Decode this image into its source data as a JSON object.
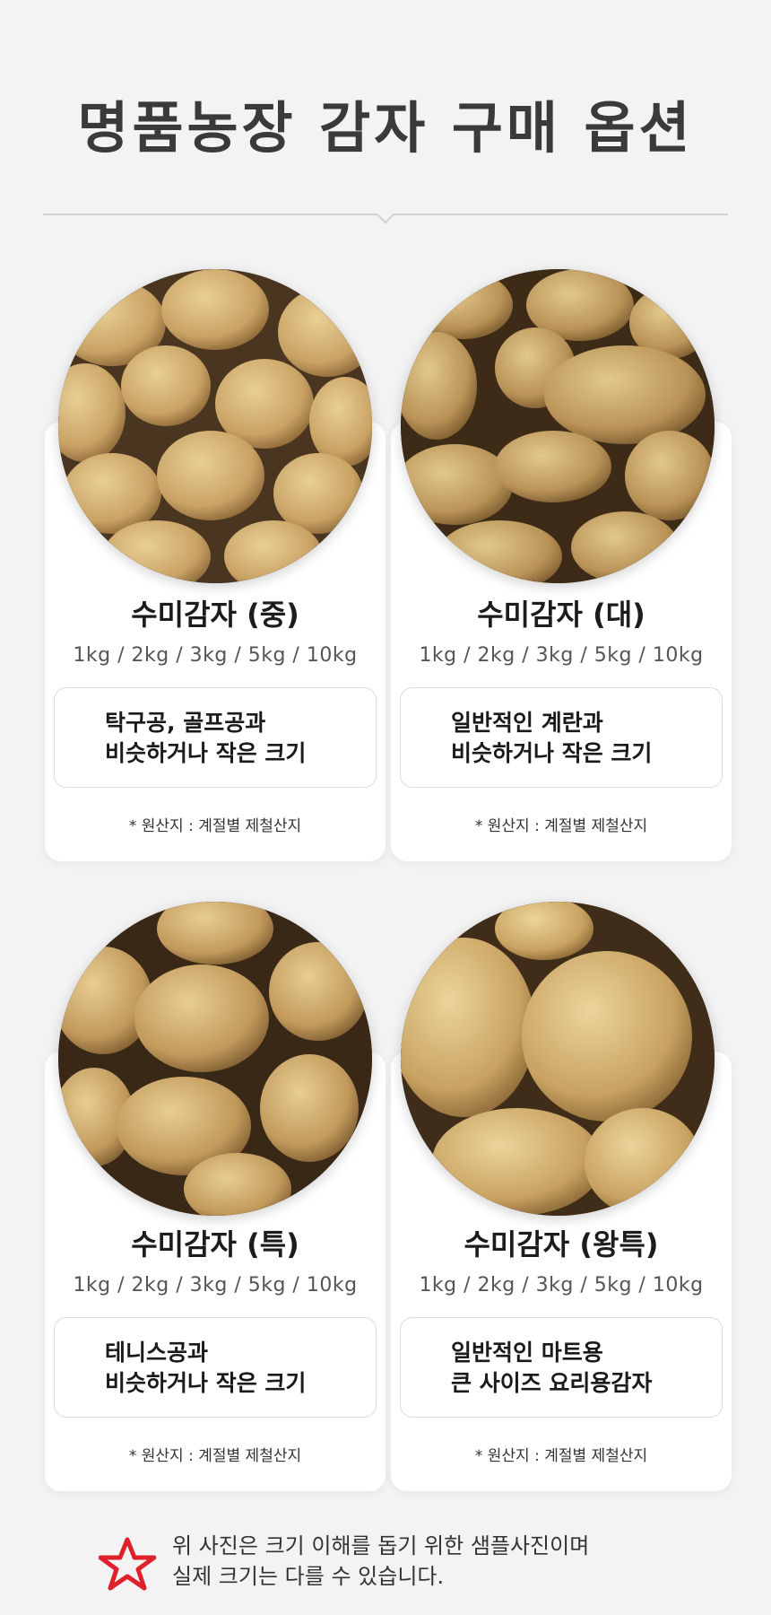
{
  "page": {
    "title": "명품농장 감자 구매 옵션"
  },
  "products": [
    {
      "name": "수미감자 (중)",
      "weights": "1kg / 2kg / 3kg / 5kg / 10kg",
      "desc": [
        "탁구공, 골프공과",
        "비슷하거나 작은 크기"
      ],
      "origin": "* 원산지 : 계절별 제철산지"
    },
    {
      "name": "수미감자 (대)",
      "weights": "1kg / 2kg / 3kg / 5kg / 10kg",
      "desc": [
        "일반적인 계란과",
        "비슷하거나 작은 크기"
      ],
      "origin": "* 원산지 : 계절별 제철산지"
    },
    {
      "name": "수미감자 (특)",
      "weights": "1kg / 2kg / 3kg / 5kg / 10kg",
      "desc": [
        "테니스공과",
        "비슷하거나 작은 크기"
      ],
      "origin": "* 원산지 : 계절별 제철산지"
    },
    {
      "name": "수미감자 (왕특)",
      "weights": "1kg / 2kg / 3kg / 5kg / 10kg",
      "desc": [
        "일반적인 마트용",
        "큰 사이즈 요리용감자"
      ],
      "origin": "* 원산지 : 계절별 제철산지"
    }
  ],
  "notice": {
    "icon": "star-icon",
    "lines": [
      "위 사진은 크기 이해를 돕기 위한 샘플사진이며",
      "실제 크기는 다를 수 있습니다."
    ]
  },
  "colors": {
    "background": "#f3f3f4",
    "card": "#ffffff",
    "star": "#e0202a"
  }
}
